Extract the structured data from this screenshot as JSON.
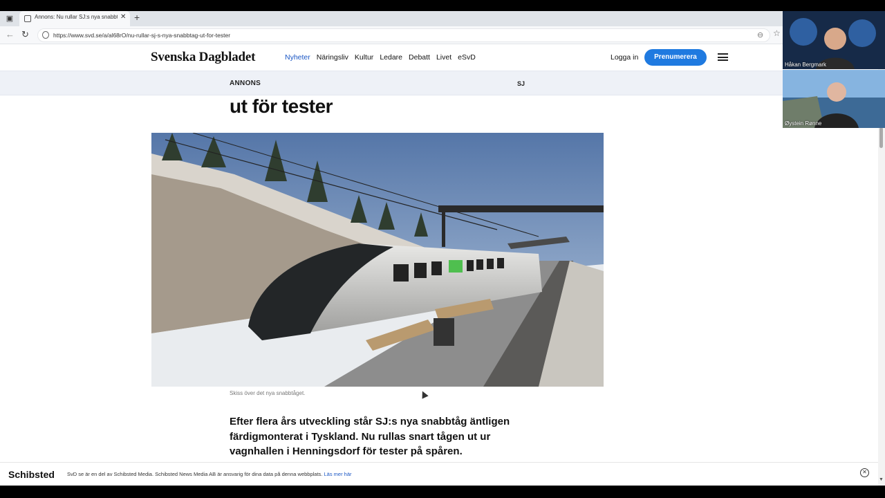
{
  "browser": {
    "tab_title": "Annons: Nu rullar SJ:s nya snabbtåg",
    "tab_close": "✕",
    "new_tab": "+",
    "url": "https://www.svd.se/a/al68rO/nu-rullar-sj-s-nya-snabbtag-ut-for-tester"
  },
  "site": {
    "logo": "Svenska Dagbladet",
    "nav": [
      "Nyheter",
      "Näringsliv",
      "Kultur",
      "Ledare",
      "Debatt",
      "Livet",
      "eSvD"
    ],
    "login": "Logga in",
    "subscribe": "Prenumerera"
  },
  "ad_bar": {
    "label": "ANNONS",
    "sponsor": "SJ"
  },
  "article": {
    "headline": "ut för tester",
    "caption": "Skiss över det nya snabbtåget.",
    "lead": "Efter flera års utveckling står SJ:s nya snabbtåg äntligen färdigmonterat i Tyskland. Nu rullas snart tågen ut ur vagnhallen i Henningsdorf för tester på spåren."
  },
  "footer": {
    "brand": "Schibsted",
    "text": "SvD se är en del av Schibsted Media. Schibsted News Media AB är ansvarig för dina data på denna webbplats.",
    "link": "Läs mer här"
  },
  "participants": [
    {
      "name": "Håkan Bergmark"
    },
    {
      "name": "Øystein Rønne"
    }
  ],
  "colors": {
    "accent": "#1f7ae0",
    "nav_active": "#1a56c4",
    "ad_bar": "#eef1f7"
  }
}
